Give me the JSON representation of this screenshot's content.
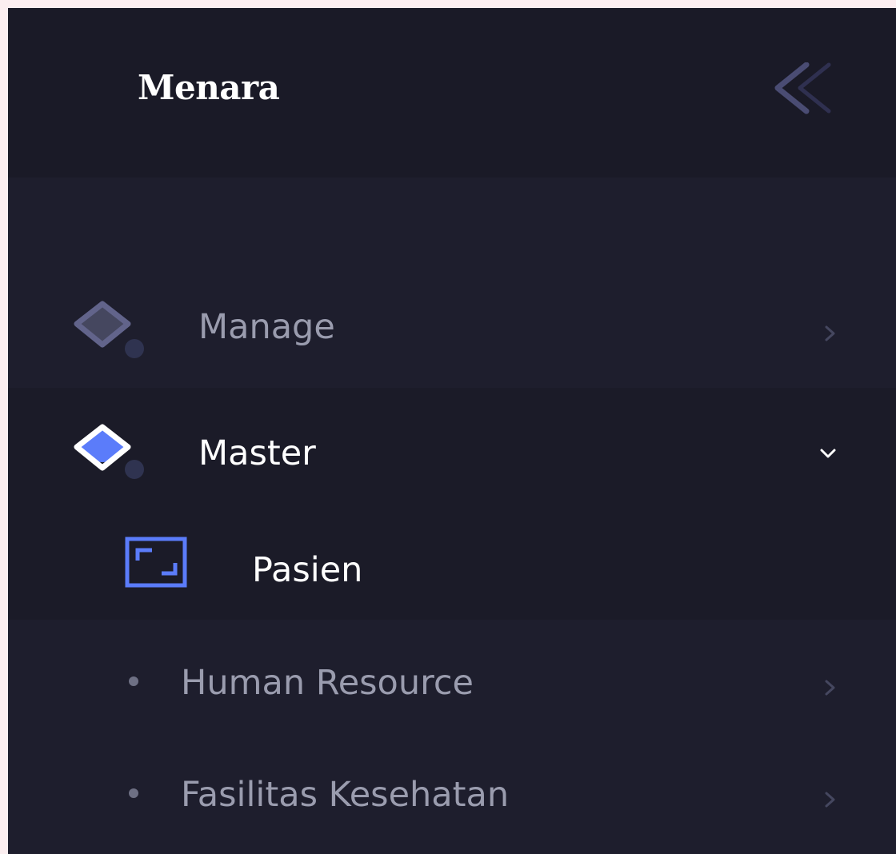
{
  "brand": {
    "title": "Menara"
  },
  "colors": {
    "accent": "#5b7cfa",
    "sidebar_bg": "#1e1e2d",
    "header_bg": "#1a1a27",
    "muted_text": "#9a9cae",
    "active_text": "#ffffff"
  },
  "menu": {
    "manage": {
      "label": "Manage",
      "icon": "drop-box-icon",
      "arrow": "chevron-right-icon"
    },
    "master": {
      "label": "Master",
      "icon": "drop-box-icon",
      "arrow": "chevron-down-icon",
      "expanded": true
    },
    "pasien": {
      "label": "Pasien",
      "icon": "frame-icon",
      "active": true
    },
    "human_resource": {
      "label": "Human Resource",
      "icon": "bullet",
      "arrow": "chevron-right-icon"
    },
    "fasilitas_kesehatan": {
      "label": "Fasilitas Kesehatan",
      "icon": "bullet",
      "arrow": "chevron-right-icon"
    }
  }
}
